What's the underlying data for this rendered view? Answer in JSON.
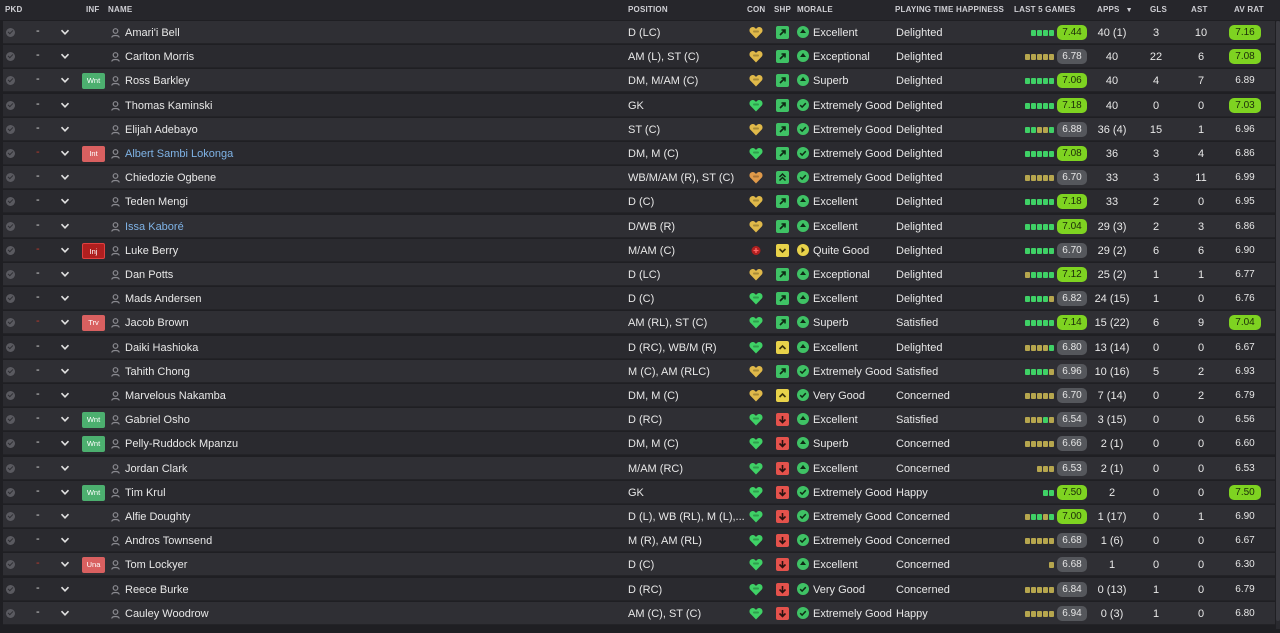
{
  "columns": {
    "pkd": "PKD",
    "inf": "INF",
    "name": "NAME",
    "position": "POSITION",
    "con": "CON",
    "shp": "SHP",
    "morale": "MORALE",
    "playing_time": "PLAYING TIME HAPPINESS",
    "last5": "LAST 5 GAMES",
    "apps": "APPS",
    "gls": "GLS",
    "ast": "AST",
    "av_rat": "AV RAT"
  },
  "sort_icon": "sort-down-icon",
  "colors": {
    "good": "#3fc265",
    "bad": "#e4524c",
    "warn": "#e8d24a",
    "rating_high": "#7ed321",
    "link_blue": "#7fb3e6"
  },
  "rows": [
    {
      "sel": "-",
      "inf": "",
      "name": "Amari'i Bell",
      "pos": "D (LC)",
      "con": "yellow-heart",
      "shp": "g-up",
      "morale_icon": "g-up",
      "morale": "Excellent",
      "pth": "Delighted",
      "last5": "gggg",
      "rating": "7.44",
      "rating_style": "hi",
      "apps": "40 (1)",
      "gls": "3",
      "ast": "10",
      "avrat": "7.16",
      "avrat_hi": true
    },
    {
      "sel": "-",
      "inf": "",
      "name": "Carlton Morris",
      "pos": "AM (L), ST (C)",
      "con": "yellow-heart",
      "shp": "g-up",
      "morale_icon": "g-up",
      "morale": "Exceptional",
      "pth": "Delighted",
      "last5": "ooooo",
      "rating": "6.78",
      "rating_style": "md",
      "apps": "40",
      "gls": "22",
      "ast": "6",
      "avrat": "7.08",
      "avrat_hi": true
    },
    {
      "sel": "-",
      "inf": "Wnt",
      "name": "Ross Barkley",
      "pos": "DM, M/AM (C)",
      "con": "yellow-heart",
      "shp": "g-up",
      "morale_icon": "g-up",
      "morale": "Superb",
      "pth": "Delighted",
      "last5": "ggggg",
      "rating": "7.06",
      "rating_style": "hi",
      "apps": "40",
      "gls": "4",
      "ast": "7",
      "avrat": "6.89",
      "avrat_hi": false
    },
    {
      "sel": "-",
      "inf": "",
      "name": "Thomas Kaminski",
      "pos": "GK",
      "con": "green-heart",
      "shp": "g-up",
      "morale_icon": "g-check",
      "morale": "Extremely Good",
      "pth": "Delighted",
      "last5": "ggggg",
      "rating": "7.18",
      "rating_style": "hi",
      "apps": "40",
      "gls": "0",
      "ast": "0",
      "avrat": "7.03",
      "avrat_hi": true
    },
    {
      "sel": "-",
      "inf": "",
      "name": "Elijah Adebayo",
      "pos": "ST (C)",
      "con": "yellow-heart",
      "shp": "g-up",
      "morale_icon": "g-check",
      "morale": "Extremely Good",
      "pth": "Delighted",
      "last5": "ggoog",
      "rating": "6.88",
      "rating_style": "md",
      "apps": "36 (4)",
      "gls": "15",
      "ast": "1",
      "avrat": "6.96",
      "avrat_hi": false
    },
    {
      "sel": "-",
      "inf": "Int",
      "name": "Albert Sambi Lokonga",
      "name_blue": true,
      "pos": "DM, M (C)",
      "con": "green-heart",
      "shp": "g-up",
      "morale_icon": "g-check",
      "morale": "Extremely Good",
      "pth": "Delighted",
      "last5": "ggggg",
      "rating": "7.08",
      "rating_style": "hi",
      "apps": "36",
      "gls": "3",
      "ast": "4",
      "avrat": "6.86",
      "avrat_hi": false
    },
    {
      "sel": "-",
      "inf": "",
      "name": "Chiedozie Ogbene",
      "pos": "WB/M/AM (R), ST (C)",
      "con": "orange-heart",
      "shp": "g-double",
      "morale_icon": "g-check",
      "morale": "Extremely Good",
      "pth": "Delighted",
      "last5": "ooooo",
      "rating": "6.70",
      "rating_style": "md",
      "apps": "33",
      "gls": "3",
      "ast": "11",
      "avrat": "6.99",
      "avrat_hi": false
    },
    {
      "sel": "-",
      "inf": "",
      "name": "Teden Mengi",
      "pos": "D (C)",
      "con": "yellow-heart",
      "shp": "g-up",
      "morale_icon": "g-up",
      "morale": "Excellent",
      "pth": "Delighted",
      "last5": "ggggg",
      "rating": "7.18",
      "rating_style": "hi",
      "apps": "33",
      "gls": "2",
      "ast": "0",
      "avrat": "6.95",
      "avrat_hi": false
    },
    {
      "sel": "-",
      "inf": "",
      "name": "Issa Kaboré",
      "name_blue": true,
      "pos": "D/WB (R)",
      "con": "yellow-heart",
      "shp": "g-up",
      "morale_icon": "g-up",
      "morale": "Excellent",
      "pth": "Delighted",
      "last5": "ggggg",
      "rating": "7.04",
      "rating_style": "hi",
      "apps": "29 (3)",
      "gls": "2",
      "ast": "3",
      "avrat": "6.86",
      "avrat_hi": false
    },
    {
      "sel": "-",
      "inf": "Inj",
      "name": "Luke Berry",
      "pos": "M/AM (C)",
      "con": "injury-cross",
      "shp": "y-down",
      "morale_icon": "y-right",
      "morale": "Quite Good",
      "pth": "Delighted",
      "last5": "ggggg",
      "rating": "6.70",
      "rating_style": "md",
      "apps": "29 (2)",
      "gls": "6",
      "ast": "6",
      "avrat": "6.90",
      "avrat_hi": false
    },
    {
      "sel": "-",
      "inf": "",
      "name": "Dan Potts",
      "pos": "D (LC)",
      "con": "yellow-heart",
      "shp": "g-up",
      "morale_icon": "g-up",
      "morale": "Exceptional",
      "pth": "Delighted",
      "last5": "ogggg",
      "rating": "7.12",
      "rating_style": "hi",
      "apps": "25 (2)",
      "gls": "1",
      "ast": "1",
      "avrat": "6.77",
      "avrat_hi": false
    },
    {
      "sel": "-",
      "inf": "",
      "name": "Mads Andersen",
      "pos": "D (C)",
      "con": "green-heart",
      "shp": "g-up",
      "morale_icon": "g-up",
      "morale": "Excellent",
      "pth": "Delighted",
      "last5": "ggggo",
      "rating": "6.82",
      "rating_style": "md",
      "apps": "24 (15)",
      "gls": "1",
      "ast": "0",
      "avrat": "6.76",
      "avrat_hi": false
    },
    {
      "sel": "-",
      "inf": "Trv",
      "name": "Jacob Brown",
      "pos": "AM (RL), ST (C)",
      "con": "green-heart",
      "shp": "g-up",
      "morale_icon": "g-up",
      "morale": "Superb",
      "pth": "Satisfied",
      "last5": "ggggg",
      "rating": "7.14",
      "rating_style": "hi",
      "apps": "15 (22)",
      "gls": "6",
      "ast": "9",
      "avrat": "7.04",
      "avrat_hi": true
    },
    {
      "sel": "-",
      "inf": "",
      "name": "Daiki Hashioka",
      "pos": "D (RC), WB/M (R)",
      "con": "green-heart",
      "shp": "y-up",
      "morale_icon": "g-up",
      "morale": "Excellent",
      "pth": "Delighted",
      "last5": "oooog",
      "rating": "6.80",
      "rating_style": "md",
      "apps": "13 (14)",
      "gls": "0",
      "ast": "0",
      "avrat": "6.67",
      "avrat_hi": false
    },
    {
      "sel": "-",
      "inf": "",
      "name": "Tahith Chong",
      "pos": "M (C), AM (RLC)",
      "con": "yellow-heart",
      "shp": "g-up",
      "morale_icon": "g-check",
      "morale": "Extremely Good",
      "pth": "Satisfied",
      "last5": "ggggo",
      "rating": "6.96",
      "rating_style": "md",
      "apps": "10 (16)",
      "gls": "5",
      "ast": "2",
      "avrat": "6.93",
      "avrat_hi": false
    },
    {
      "sel": "-",
      "inf": "",
      "name": "Marvelous Nakamba",
      "pos": "DM, M (C)",
      "con": "yellow-heart",
      "shp": "y-up",
      "morale_icon": "g-check",
      "morale": "Very Good",
      "pth": "Concerned",
      "last5": "ooooo",
      "rating": "6.70",
      "rating_style": "md",
      "apps": "7 (14)",
      "gls": "0",
      "ast": "2",
      "avrat": "6.79",
      "avrat_hi": false
    },
    {
      "sel": "-",
      "inf": "Wnt",
      "name": "Gabriel Osho",
      "pos": "D (RC)",
      "con": "green-heart",
      "shp": "r-down",
      "morale_icon": "g-up",
      "morale": "Excellent",
      "pth": "Satisfied",
      "last5": "ooogo",
      "rating": "6.54",
      "rating_style": "md",
      "apps": "3 (15)",
      "gls": "0",
      "ast": "0",
      "avrat": "6.56",
      "avrat_hi": false
    },
    {
      "sel": "-",
      "inf": "Wnt",
      "name": "Pelly-Ruddock Mpanzu",
      "pos": "DM, M (C)",
      "con": "green-heart",
      "shp": "r-down",
      "morale_icon": "g-up",
      "morale": "Superb",
      "pth": "Concerned",
      "last5": "ooooo",
      "rating": "6.66",
      "rating_style": "md",
      "apps": "2 (1)",
      "gls": "0",
      "ast": "0",
      "avrat": "6.60",
      "avrat_hi": false
    },
    {
      "sel": "-",
      "inf": "",
      "name": "Jordan Clark",
      "pos": "M/AM (RC)",
      "con": "green-heart",
      "shp": "r-down",
      "morale_icon": "g-up",
      "morale": "Excellent",
      "pth": "Concerned",
      "last5": "ooo",
      "rating": "6.53",
      "rating_style": "md",
      "apps": "2 (1)",
      "gls": "0",
      "ast": "0",
      "avrat": "6.53",
      "avrat_hi": false
    },
    {
      "sel": "-",
      "inf": "Wnt",
      "name": "Tim Krul",
      "pos": "GK",
      "con": "green-heart",
      "shp": "r-down",
      "morale_icon": "g-check",
      "morale": "Extremely Good",
      "pth": "Happy",
      "last5": "gg",
      "rating": "7.50",
      "rating_style": "hi",
      "apps": "2",
      "gls": "0",
      "ast": "0",
      "avrat": "7.50",
      "avrat_hi": true
    },
    {
      "sel": "-",
      "inf": "",
      "name": "Alfie Doughty",
      "pos": "D (L), WB (RL), M (L),...",
      "con": "green-heart",
      "shp": "r-down",
      "morale_icon": "g-check",
      "morale": "Extremely Good",
      "pth": "Concerned",
      "last5": "oggog",
      "rating": "7.00",
      "rating_style": "hi",
      "apps": "1 (17)",
      "gls": "0",
      "ast": "1",
      "avrat": "6.90",
      "avrat_hi": false
    },
    {
      "sel": "-",
      "inf": "",
      "name": "Andros Townsend",
      "pos": "M (R), AM (RL)",
      "con": "green-heart",
      "shp": "r-down",
      "morale_icon": "g-check",
      "morale": "Extremely Good",
      "pth": "Concerned",
      "last5": "ooooo",
      "rating": "6.68",
      "rating_style": "md",
      "apps": "1 (6)",
      "gls": "0",
      "ast": "0",
      "avrat": "6.67",
      "avrat_hi": false
    },
    {
      "sel": "-",
      "inf": "Una",
      "name": "Tom Lockyer",
      "pos": "D (C)",
      "con": "green-heart",
      "shp": "r-down",
      "morale_icon": "g-up",
      "morale": "Excellent",
      "pth": "Concerned",
      "last5": "o",
      "rating": "6.68",
      "rating_style": "md",
      "apps": "1",
      "gls": "0",
      "ast": "0",
      "avrat": "6.30",
      "avrat_hi": false
    },
    {
      "sel": "-",
      "inf": "",
      "name": "Reece Burke",
      "pos": "D (RC)",
      "con": "green-heart",
      "shp": "r-down",
      "morale_icon": "g-check",
      "morale": "Very Good",
      "pth": "Concerned",
      "last5": "ooooo",
      "rating": "6.84",
      "rating_style": "md",
      "apps": "0 (13)",
      "gls": "1",
      "ast": "0",
      "avrat": "6.79",
      "avrat_hi": false
    },
    {
      "sel": "-",
      "inf": "",
      "name": "Cauley Woodrow",
      "pos": "AM (C), ST (C)",
      "con": "green-heart",
      "shp": "r-down",
      "morale_icon": "g-check",
      "morale": "Extremely Good",
      "pth": "Happy",
      "last5": "ooooo",
      "rating": "6.94",
      "rating_style": "md",
      "apps": "0 (3)",
      "gls": "1",
      "ast": "0",
      "avrat": "6.80",
      "avrat_hi": false
    }
  ]
}
